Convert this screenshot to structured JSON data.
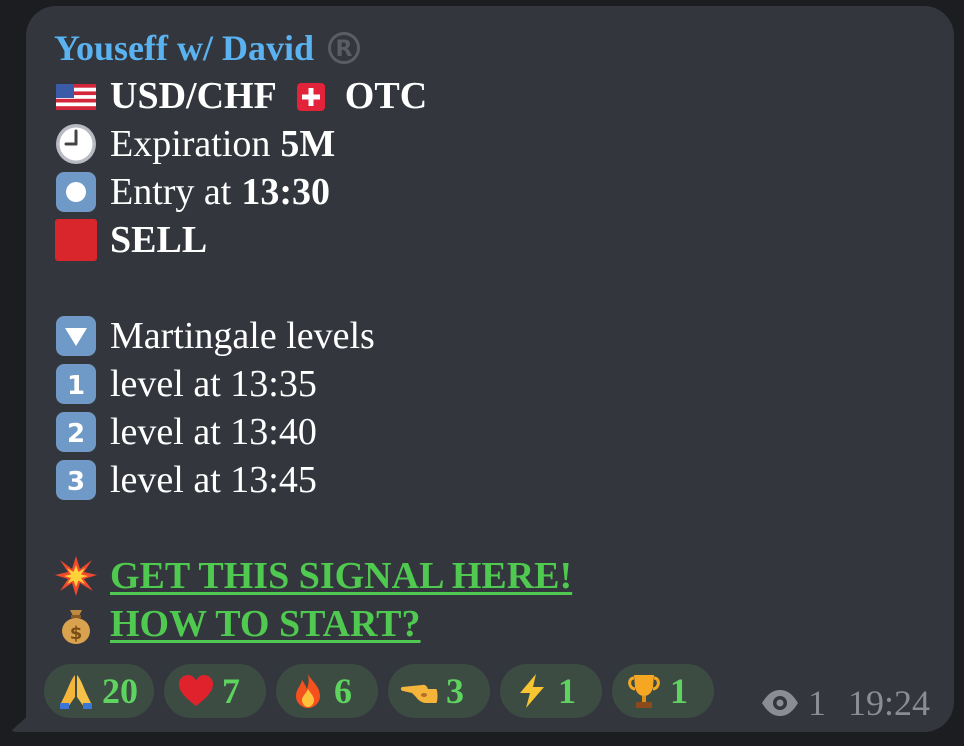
{
  "message": {
    "author": "Youseff w/ David",
    "pair_line": {
      "pair": "USD/CHF",
      "suffix": "OTC"
    },
    "expiration": {
      "label": "Expiration",
      "value": "5M"
    },
    "entry": {
      "label": "Entry at",
      "value": "13:30"
    },
    "direction": "SELL",
    "martingale_title": "Martingale levels",
    "levels": [
      "level at 13:35",
      "level at 13:40",
      "level at 13:45"
    ],
    "links": {
      "signal": "GET THIS SIGNAL HERE!",
      "start": "HOW TO START?"
    }
  },
  "reactions": [
    {
      "emoji": "pray-icon",
      "count": "20"
    },
    {
      "emoji": "heart-icon",
      "count": "7"
    },
    {
      "emoji": "fire-icon",
      "count": "6"
    },
    {
      "emoji": "point-icon",
      "count": "3"
    },
    {
      "emoji": "lightning-icon",
      "count": "1"
    },
    {
      "emoji": "trophy-icon",
      "count": "1"
    }
  ],
  "meta": {
    "views": "1",
    "time": "19:24"
  },
  "colors": {
    "author": "#5ab3f0",
    "link": "#4fc94f",
    "bubble": "#33363d",
    "reaction_bg": "#3c4c43"
  }
}
